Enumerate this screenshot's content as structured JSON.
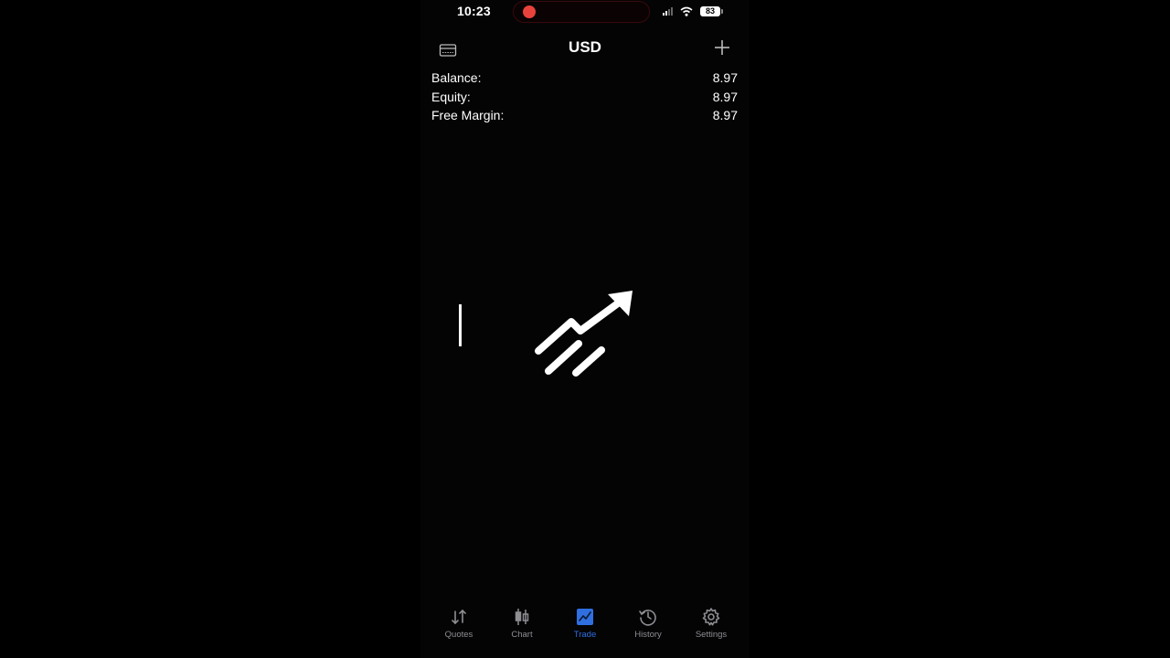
{
  "status_bar": {
    "time": "10:23",
    "battery": "83",
    "icons": [
      "recording-dot-icon",
      "cellular-signal-icon",
      "wifi-icon",
      "battery-icon"
    ]
  },
  "header": {
    "title": "USD",
    "left_icon": "card-icon",
    "right_icon": "plus-icon"
  },
  "account": {
    "rows": [
      {
        "label": "Balance:",
        "value": "8.97"
      },
      {
        "label": "Equity:",
        "value": "8.97"
      },
      {
        "label": "Free Margin:",
        "value": "8.97"
      }
    ]
  },
  "tabs": [
    {
      "label": "Quotes",
      "icon": "quotes-arrows-icon",
      "active": false
    },
    {
      "label": "Chart",
      "icon": "candlestick-icon",
      "active": false
    },
    {
      "label": "Trade",
      "icon": "trade-chart-icon",
      "active": true
    },
    {
      "label": "History",
      "icon": "history-clock-icon",
      "active": false
    },
    {
      "label": "Settings",
      "icon": "gear-icon",
      "active": false
    }
  ],
  "colors": {
    "accent": "#2f6fe0",
    "inactive": "#8e8e93",
    "recording": "#e8423c",
    "background": "#000000"
  }
}
